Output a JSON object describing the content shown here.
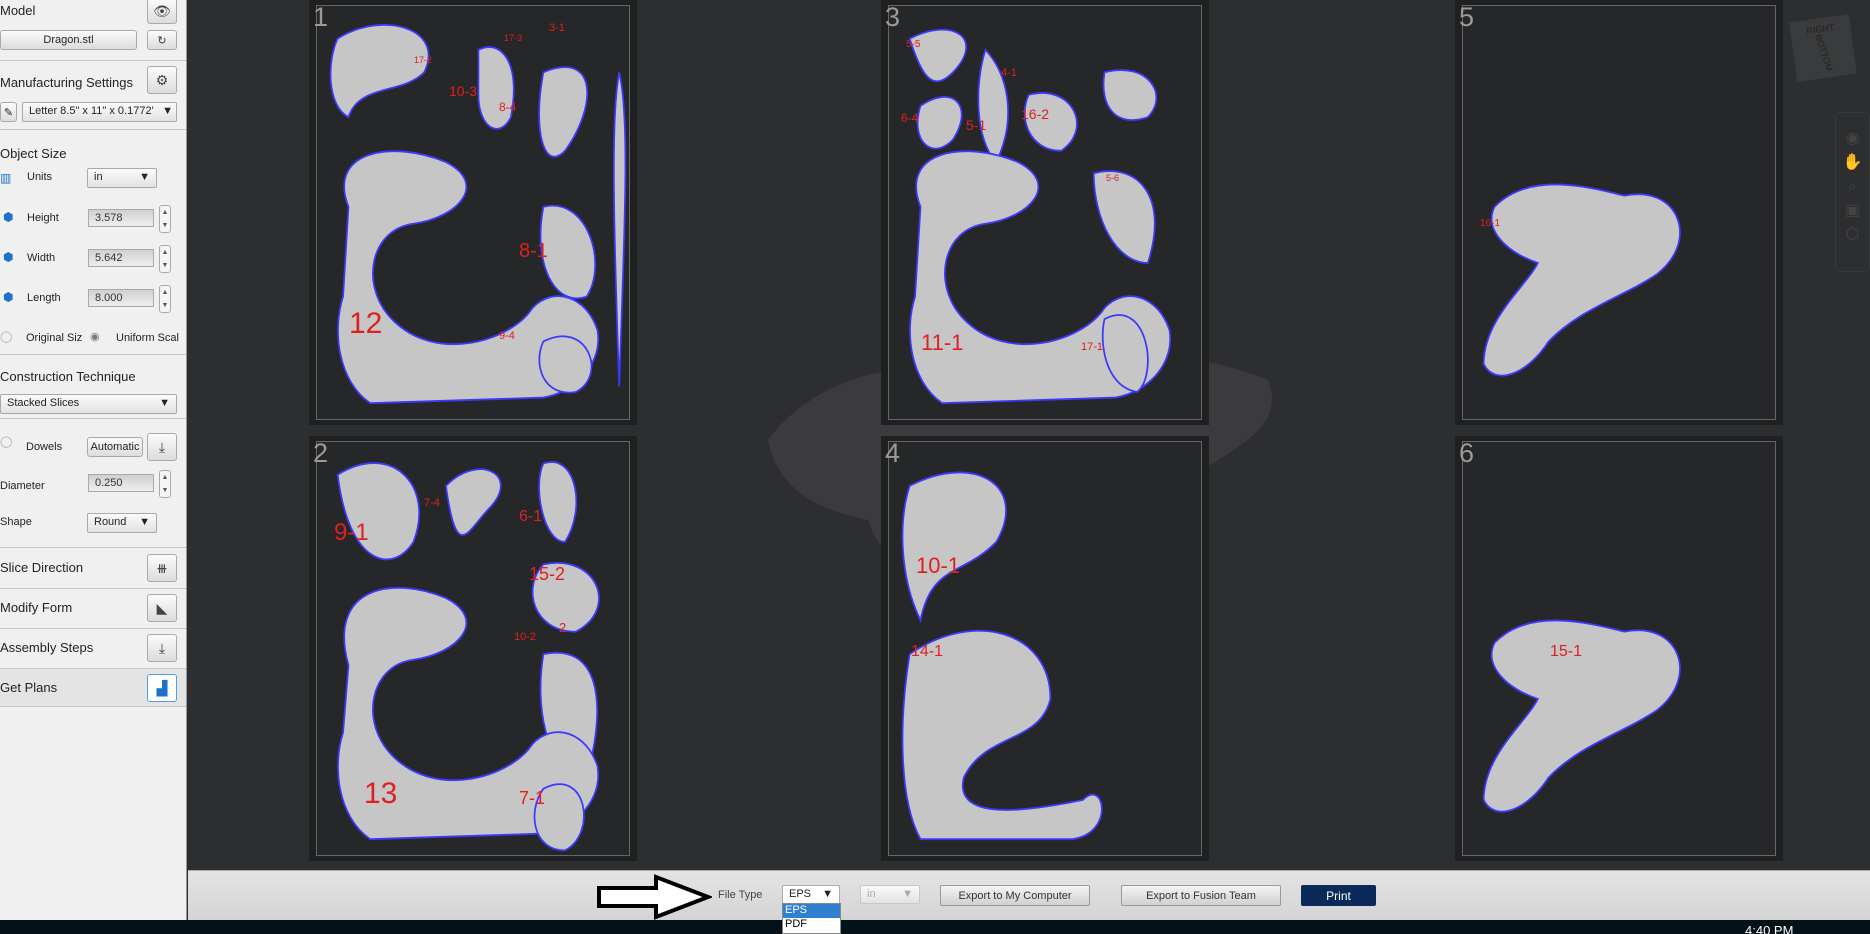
{
  "sidebar": {
    "model": {
      "title": "Model",
      "file": "Dragon.stl",
      "view_icon": "eye-icon",
      "refresh_icon": "refresh-icon"
    },
    "manufacturing": {
      "title": "Manufacturing Settings",
      "preset": "Letter 8.5\" x 11\" x 0.1772'",
      "gear_icon": "gear-icon",
      "edit_icon": "pencil-icon"
    },
    "object_size": {
      "title": "Object Size",
      "units_label": "Units",
      "units_value": "in",
      "height_label": "Height",
      "height_value": "3.578",
      "width_label": "Width",
      "width_value": "5.642",
      "length_label": "Length",
      "length_value": "8.000",
      "original_size": "Original Siz",
      "uniform_scale": "Uniform Scal"
    },
    "construction": {
      "title": "Construction Technique",
      "value": "Stacked Slices"
    },
    "dowels": {
      "label": "Dowels",
      "mode": "Automatic",
      "diameter_label": "Diameter",
      "diameter_value": "0.250",
      "shape_label": "Shape",
      "shape_value": "Round"
    },
    "steps": [
      {
        "label": "Slice Direction",
        "icon": "slice-direction-icon"
      },
      {
        "label": "Modify Form",
        "icon": "modify-form-icon"
      },
      {
        "label": "Assembly Steps",
        "icon": "assembly-steps-icon"
      },
      {
        "label": "Get Plans",
        "icon": "get-plans-icon",
        "active": true
      }
    ]
  },
  "viewcube": {
    "face1": "RIGHT",
    "face2": "BOTTOM"
  },
  "pages": [
    {
      "num": "1",
      "labels": [
        "12",
        "10-3",
        "8-4",
        "8-1",
        "9-4",
        "17-2",
        "17-3",
        "3-1"
      ]
    },
    {
      "num": "2",
      "labels": [
        "9-1",
        "7-4",
        "6-1",
        "15-2",
        "10-2",
        "13",
        "7-1",
        "2"
      ]
    },
    {
      "num": "3",
      "labels": [
        "5-5",
        "6-4",
        "5-1",
        "4-1",
        "16-2",
        "11-1",
        "17-1",
        "5-6"
      ]
    },
    {
      "num": "4",
      "labels": [
        "10-1",
        "14-1"
      ]
    },
    {
      "num": "5",
      "labels": [
        "16-1"
      ]
    },
    {
      "num": "6",
      "labels": [
        "15-1"
      ]
    }
  ],
  "bottom": {
    "file_type_label": "File Type",
    "file_type_value": "EPS",
    "file_type_options": [
      "EPS",
      "PDF"
    ],
    "units_value": "in",
    "export_computer": "Export to My Computer",
    "export_fusion": "Export to Fusion Team",
    "print": "Print",
    "accent": "#0b2a5a"
  },
  "taskbar": {
    "clock": "4:40 PM"
  }
}
